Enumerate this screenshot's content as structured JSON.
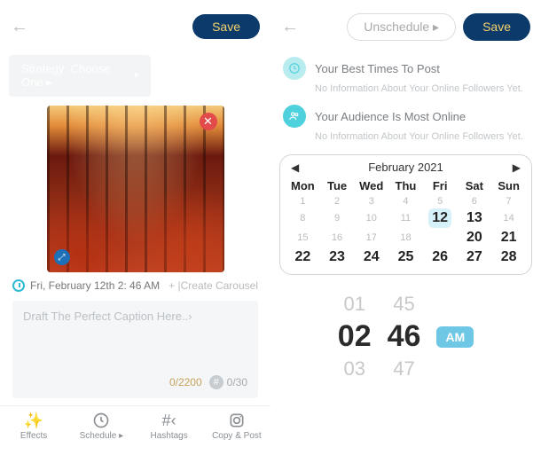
{
  "left": {
    "save_label": "Save",
    "strategy": {
      "label": "Strategy: Choose One ▸"
    },
    "schedule": {
      "datetime": "Fri, February 12th 2: 46 AM"
    },
    "create_carousel": "+ |Create Carousel",
    "caption": {
      "placeholder": "Draft The Perfect Caption Here..›",
      "char_counter": "0/2200",
      "hashtag_counter": "0/30"
    },
    "toolbar": {
      "effects": "Effects",
      "schedule": "Schedule ▸",
      "hashtags": "Hashtags",
      "copy_post": "Copy & Post"
    }
  },
  "right": {
    "unschedule_label": "Unschedule ▸",
    "save_label": "Save",
    "best_times": {
      "title": "Your Best Times To Post",
      "sub": "No Information About Your Online Followers Yet."
    },
    "audience": {
      "title": "Your Audience Is Most Online",
      "sub": "No Information About Your Online Followers Yet."
    },
    "calendar": {
      "month_label": "February 2021",
      "dow": [
        "Mon",
        "Tue",
        "Wed",
        "Thu",
        "Fri",
        "Sat",
        "Sun"
      ],
      "rows": [
        {
          "cells": [
            {
              "n": "1",
              "style": "dim"
            },
            {
              "n": "2",
              "style": "dim"
            },
            {
              "n": "3",
              "style": "dim"
            },
            {
              "n": "4",
              "style": "dim"
            },
            {
              "n": "5",
              "style": "dim"
            },
            {
              "n": "6",
              "style": "dim"
            },
            {
              "n": "7",
              "style": "dim"
            }
          ]
        },
        {
          "cells": [
            {
              "n": "8",
              "style": "dim"
            },
            {
              "n": "9",
              "style": "dim"
            },
            {
              "n": "10",
              "style": "dim"
            },
            {
              "n": "11",
              "style": "dim"
            },
            {
              "n": "12",
              "style": "big",
              "selected": true
            },
            {
              "n": "13",
              "style": "big"
            },
            {
              "n": "14",
              "style": "dim"
            }
          ]
        },
        {
          "cells": [
            {
              "n": "15",
              "style": "dim"
            },
            {
              "n": "16",
              "style": "dim"
            },
            {
              "n": "17",
              "style": "dim"
            },
            {
              "n": "18",
              "style": "dim"
            },
            {
              "n": "",
              "style": "dim"
            },
            {
              "n": "20",
              "style": "big"
            },
            {
              "n": "21",
              "style": "big"
            }
          ]
        },
        {
          "cells": [
            {
              "n": "22",
              "style": "big"
            },
            {
              "n": "23",
              "style": "big"
            },
            {
              "n": "24",
              "style": "big"
            },
            {
              "n": "25",
              "style": "big"
            },
            {
              "n": "26",
              "style": "big"
            },
            {
              "n": "27",
              "style": "big"
            },
            {
              "n": "28",
              "style": "big"
            }
          ]
        }
      ]
    },
    "time": {
      "hour_prev": "01",
      "hour": "02",
      "hour_next": "03",
      "min_prev": "45",
      "min": "46",
      "min_next": "47",
      "ampm": "AM"
    }
  }
}
